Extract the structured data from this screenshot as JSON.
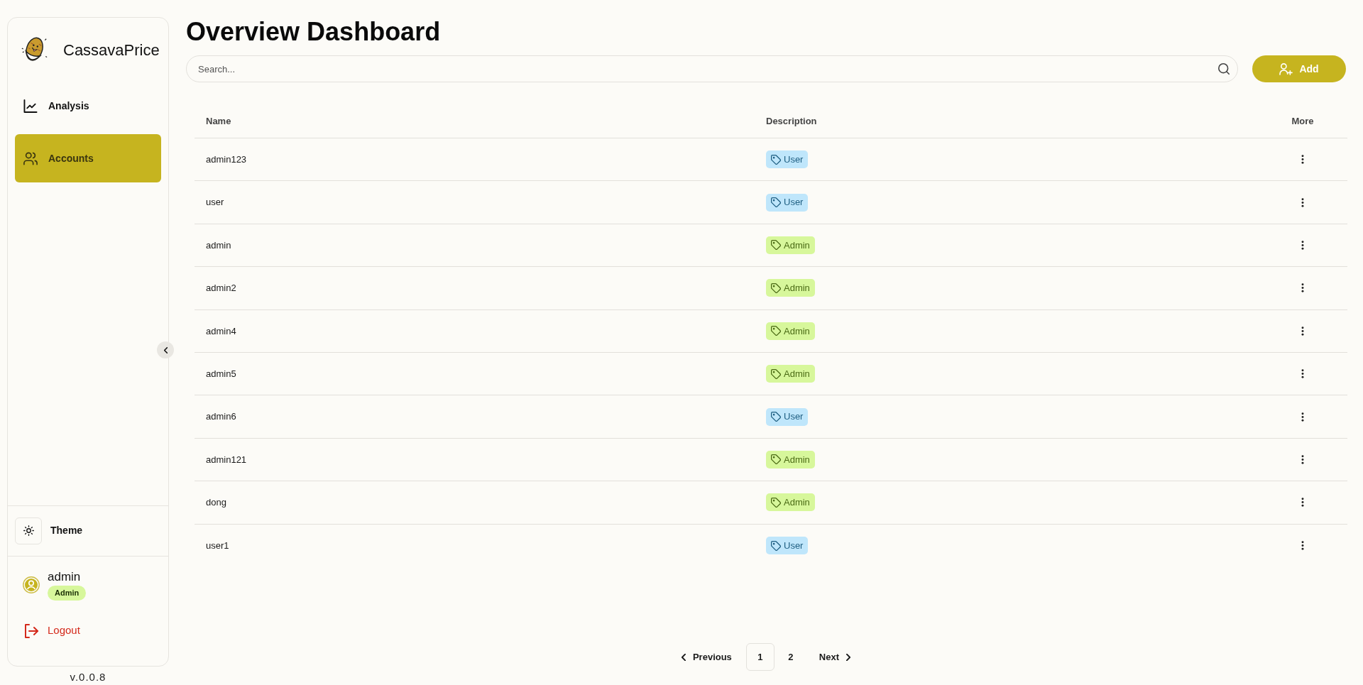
{
  "sidebar": {
    "brand": "CassavaPrice",
    "items": [
      {
        "label": "Analysis",
        "selected": false
      },
      {
        "label": "Accounts",
        "selected": true
      }
    ],
    "theme": {
      "label": "Theme"
    },
    "user": {
      "name": "admin",
      "role": "Admin"
    },
    "logout": "Logout",
    "version": "v.0.0.8"
  },
  "header": {
    "title": "Overview Dashboard",
    "search": {
      "placeholder": "Search..."
    },
    "add_button": "Add"
  },
  "table": {
    "columns": [
      "Name",
      "Description",
      "More"
    ],
    "rows": [
      {
        "name": "admin123",
        "description": "User",
        "kind": "user"
      },
      {
        "name": "user",
        "description": "User",
        "kind": "user"
      },
      {
        "name": "admin",
        "description": "Admin",
        "kind": "admin"
      },
      {
        "name": "admin2",
        "description": "Admin",
        "kind": "admin"
      },
      {
        "name": "admin4",
        "description": "Admin",
        "kind": "admin"
      },
      {
        "name": "admin5",
        "description": "Admin",
        "kind": "admin"
      },
      {
        "name": "admin6",
        "description": "User",
        "kind": "user"
      },
      {
        "name": "admin121",
        "description": "Admin",
        "kind": "admin"
      },
      {
        "name": "dong",
        "description": "Admin",
        "kind": "admin"
      },
      {
        "name": "user1",
        "description": "User",
        "kind": "user"
      }
    ]
  },
  "pagination": {
    "previous": "Previous",
    "pages": [
      {
        "label": "1",
        "selected": true
      },
      {
        "label": "2",
        "selected": false
      }
    ],
    "next": "Next"
  }
}
